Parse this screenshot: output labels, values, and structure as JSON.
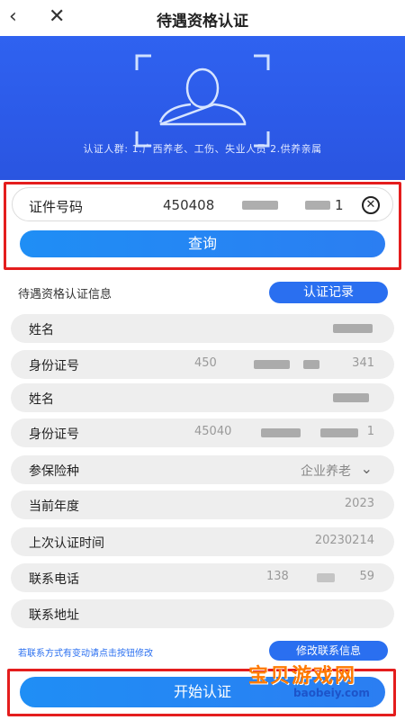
{
  "header": {
    "title": "待遇资格认证",
    "back_icon": "‹",
    "close_icon": "✕"
  },
  "banner": {
    "scope_text": "认证人群: 1.广西养老、工伤、失业人员   2.供养亲属"
  },
  "search": {
    "id_label": "证件号码",
    "id_value_prefix": "450408",
    "id_value_suffix": "1",
    "query_button": "查询"
  },
  "info": {
    "section_title": "待遇资格认证信息",
    "record_button": "认证记录",
    "fields": [
      {
        "label": "姓名",
        "value": ""
      },
      {
        "label": "身份证号",
        "value": "450",
        "value_tail": "341"
      },
      {
        "label": "姓名",
        "value": ""
      },
      {
        "label": "身份证号",
        "value": "45040",
        "value_tail": "1"
      },
      {
        "label": "参保险种",
        "value": "企业养老",
        "has_dropdown": true
      },
      {
        "label": "当前年度",
        "value": "2023"
      },
      {
        "label": "上次认证时间",
        "value": "20230214"
      },
      {
        "label": "联系电话",
        "value": "138",
        "value_tail": "59"
      },
      {
        "label": "联系地址",
        "value": ""
      }
    ],
    "hint": "若联系方式有变动请点击按钮修改",
    "contact_button": "修改联系信息"
  },
  "footer": {
    "start_button": "开始认证"
  },
  "watermark": {
    "line1": "宝贝游戏网",
    "line2": "baobeiy.com"
  },
  "colors": {
    "accent": "#2a6ff0",
    "banner": "#2c5ae8",
    "highlight": "#e41d1d"
  }
}
